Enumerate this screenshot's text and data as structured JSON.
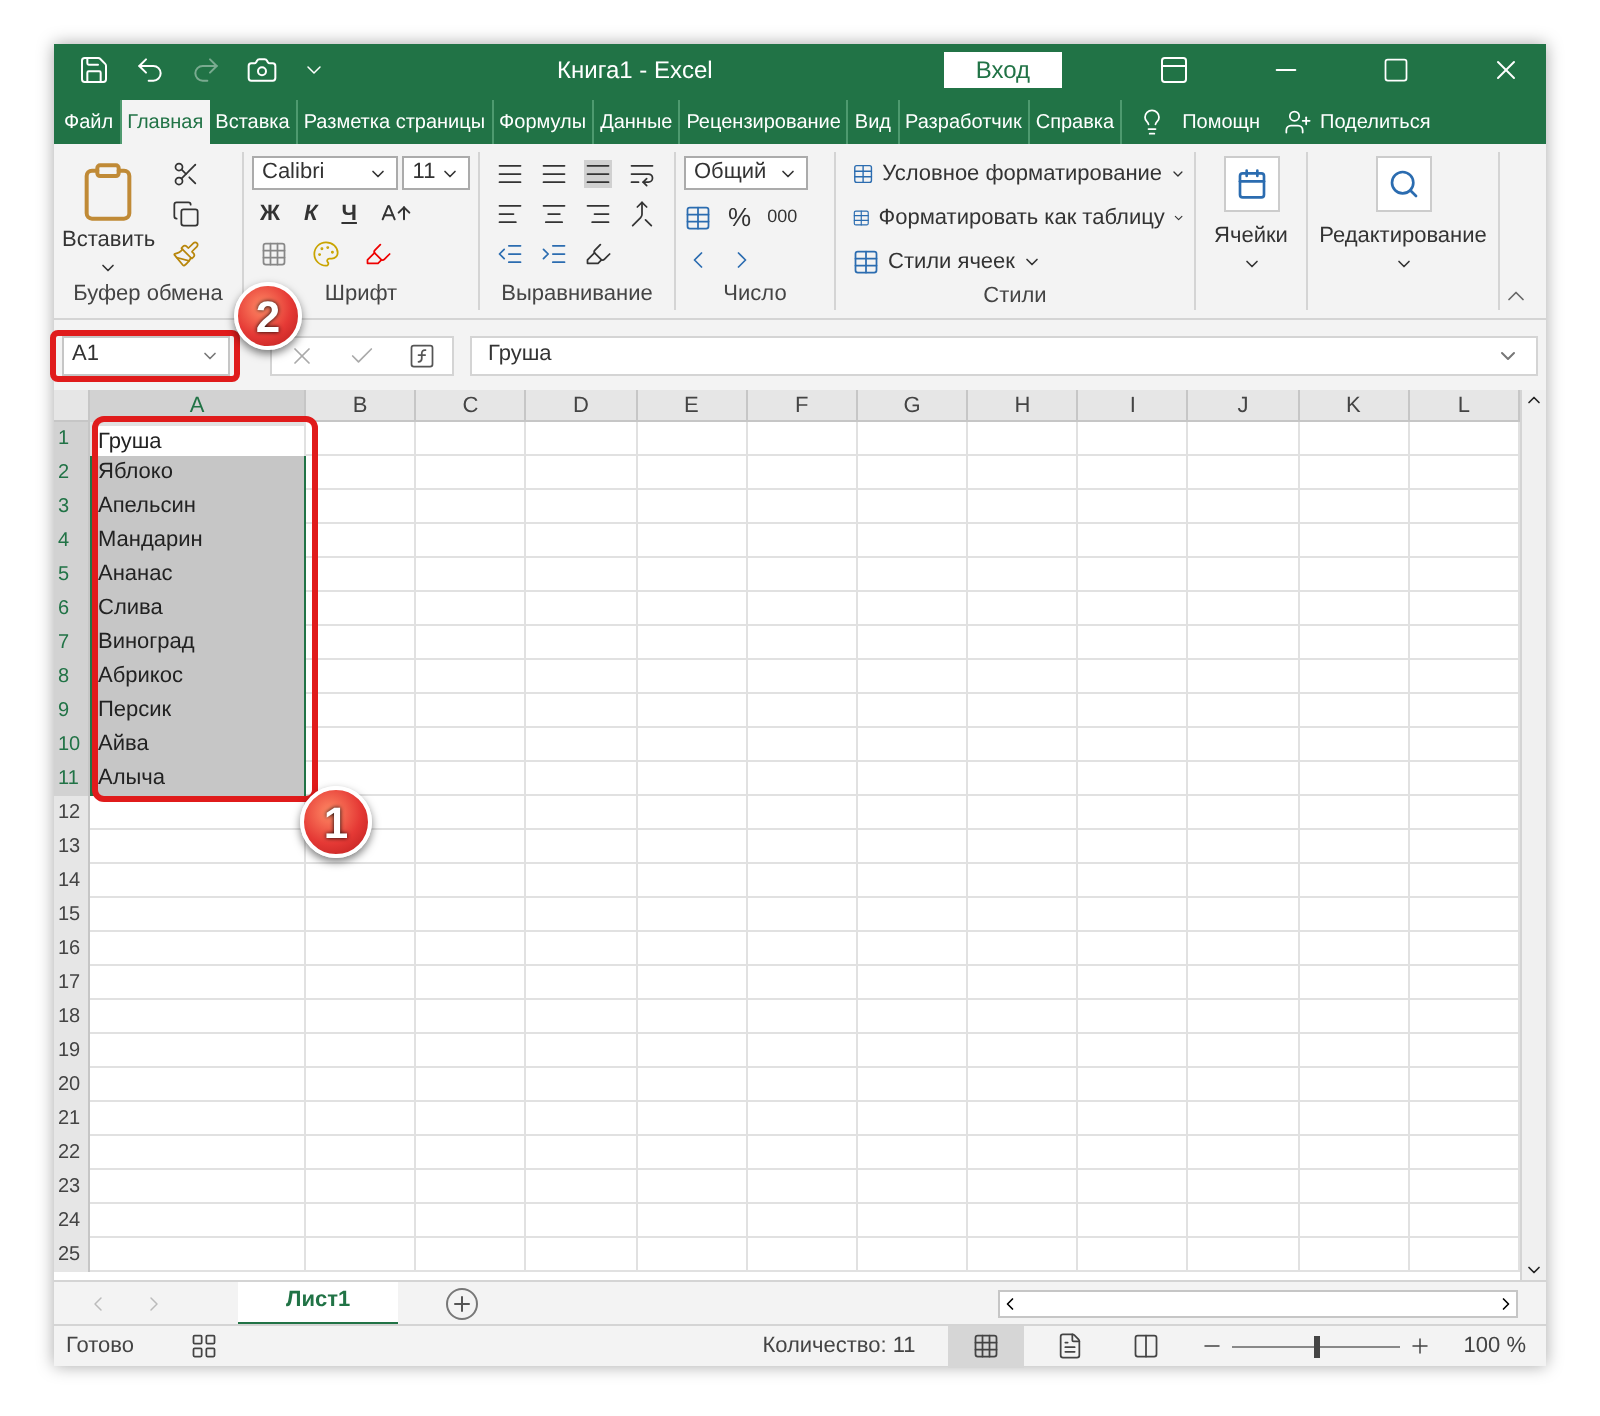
{
  "window": {
    "title": "Книга1  -  Excel",
    "signin": "Вход"
  },
  "tabs": [
    {
      "label": "Файл",
      "selected": false
    },
    {
      "label": "Главная",
      "selected": true
    },
    {
      "label": "Вставка",
      "selected": false
    },
    {
      "label": "Разметка страницы",
      "selected": false
    },
    {
      "label": "Формулы",
      "selected": false
    },
    {
      "label": "Данные",
      "selected": false
    },
    {
      "label": "Рецензирование",
      "selected": false
    },
    {
      "label": "Вид",
      "selected": false
    },
    {
      "label": "Разработчик",
      "selected": false
    },
    {
      "label": "Справка",
      "selected": false
    }
  ],
  "tell_me": "Помощн",
  "share": "Поделиться",
  "ribbon": {
    "clipboard": {
      "paste": "Вставить",
      "label": "Буфер обмена"
    },
    "font": {
      "name": "Calibri",
      "size": "11",
      "bold": "Ж",
      "italic": "К",
      "underline": "Ч",
      "label": "Шрифт"
    },
    "alignment": {
      "label": "Выравнивание"
    },
    "number": {
      "format": "Общий",
      "percent": "%",
      "thousands": "000",
      "label": "Число"
    },
    "styles": {
      "items": [
        "Условное форматирование",
        "Форматировать как таблицу",
        "Стили ячеек"
      ],
      "label": "Стили"
    },
    "cells": "Ячейки",
    "editing": "Редактирование"
  },
  "formula_bar": {
    "name_box": "A1",
    "value": "Груша",
    "callout": "2"
  },
  "sheet": {
    "callout": "1",
    "columns": [
      {
        "label": "A",
        "selected": true
      },
      {
        "label": "B",
        "selected": false
      },
      {
        "label": "C",
        "selected": false
      },
      {
        "label": "D",
        "selected": false
      },
      {
        "label": "E",
        "selected": false
      },
      {
        "label": "F",
        "selected": false
      },
      {
        "label": "G",
        "selected": false
      },
      {
        "label": "H",
        "selected": false
      },
      {
        "label": "I",
        "selected": false
      },
      {
        "label": "J",
        "selected": false
      },
      {
        "label": "K",
        "selected": false
      },
      {
        "label": "L",
        "selected": false
      }
    ],
    "rows": [
      {
        "number": "1",
        "value": "Груша",
        "selected": true,
        "active": true
      },
      {
        "number": "2",
        "value": "Яблоко",
        "selected": true,
        "active": false
      },
      {
        "number": "3",
        "value": "Апельсин",
        "selected": true,
        "active": false
      },
      {
        "number": "4",
        "value": "Мандарин",
        "selected": true,
        "active": false
      },
      {
        "number": "5",
        "value": "Ананас",
        "selected": true,
        "active": false
      },
      {
        "number": "6",
        "value": "Слива",
        "selected": true,
        "active": false
      },
      {
        "number": "7",
        "value": "Виноград",
        "selected": true,
        "active": false
      },
      {
        "number": "8",
        "value": "Абрикос",
        "selected": true,
        "active": false
      },
      {
        "number": "9",
        "value": "Персик",
        "selected": true,
        "active": false
      },
      {
        "number": "10",
        "value": "Айва",
        "selected": true,
        "active": false
      },
      {
        "number": "11",
        "value": "Алыча",
        "selected": true,
        "active": false
      },
      {
        "number": "12",
        "selected": false,
        "active": false
      },
      {
        "number": "13",
        "selected": false,
        "active": false
      },
      {
        "number": "14",
        "selected": false,
        "active": false
      },
      {
        "number": "15",
        "selected": false,
        "active": false
      },
      {
        "number": "16",
        "selected": false,
        "active": false
      },
      {
        "number": "17",
        "selected": false,
        "active": false
      },
      {
        "number": "18",
        "selected": false,
        "active": false
      },
      {
        "number": "19",
        "selected": false,
        "active": false
      },
      {
        "number": "20",
        "selected": false,
        "active": false
      },
      {
        "number": "21",
        "selected": false,
        "active": false
      },
      {
        "number": "22",
        "selected": false,
        "active": false
      },
      {
        "number": "23",
        "selected": false,
        "active": false
      },
      {
        "number": "24",
        "selected": false,
        "active": false
      },
      {
        "number": "25",
        "selected": false,
        "active": false
      }
    ]
  },
  "sheet_tabs": [
    {
      "label": "Лист1",
      "selected": true
    }
  ],
  "status_bar": {
    "ready": "Готово",
    "count": "Количество: 11",
    "zoom": "100 %",
    "zoom_level": {
      "level": 0.5
    }
  }
}
